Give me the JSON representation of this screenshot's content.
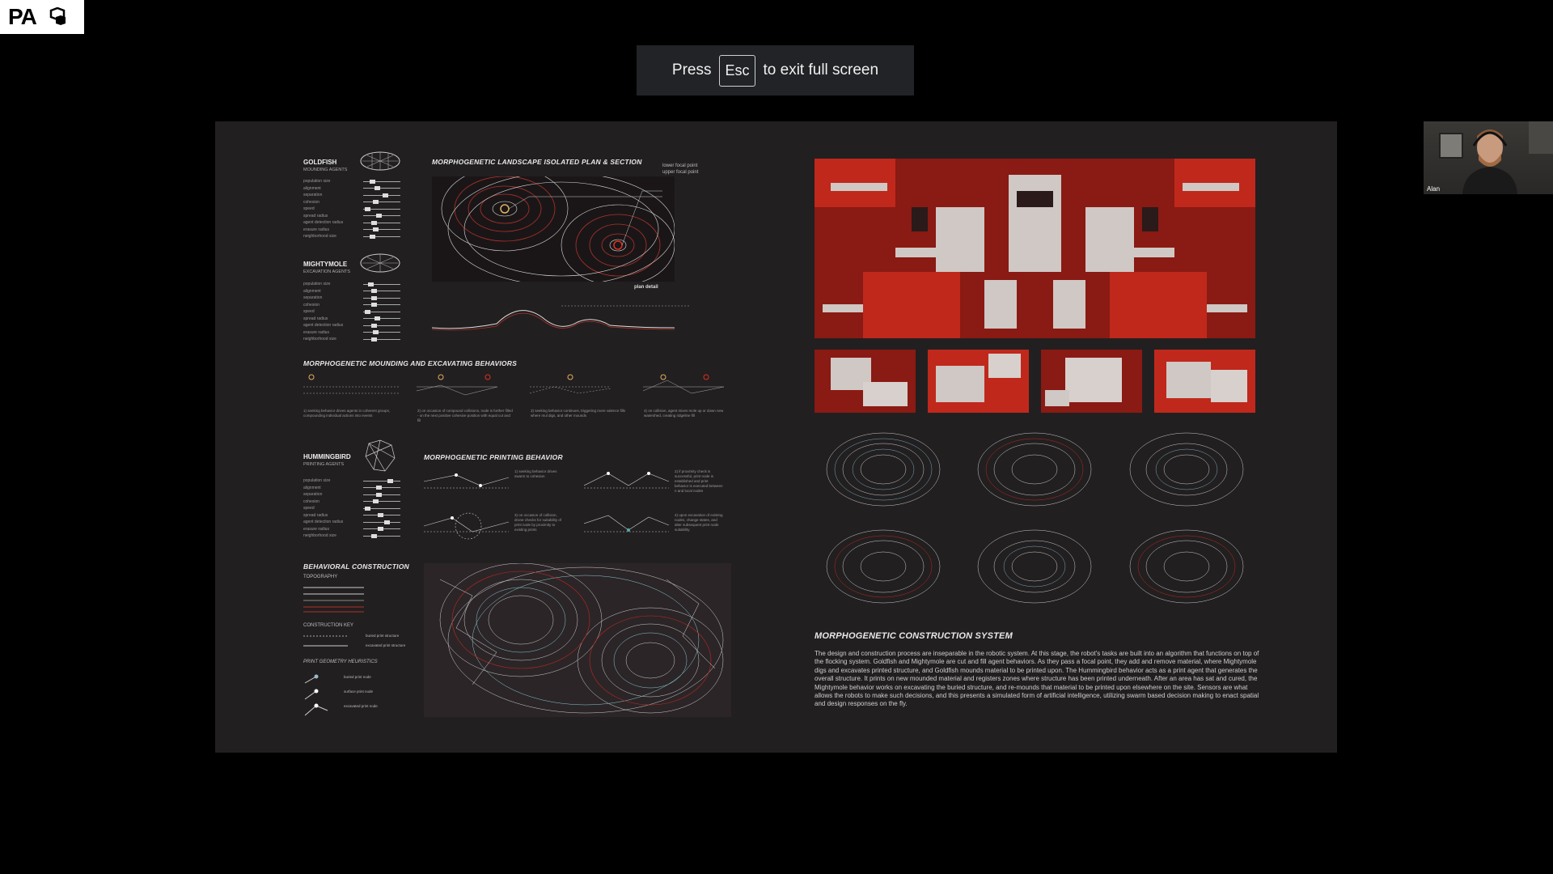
{
  "logo": {
    "text": "PA"
  },
  "fullscreen_toast": {
    "press": "Press",
    "key": "Esc",
    "rest": "to exit full screen"
  },
  "participant": {
    "name": "Alan"
  },
  "slide": {
    "goldfish": {
      "name": "GOLDFISH",
      "sub": "MOUNDING AGENTS",
      "params": [
        "population size",
        "alignment",
        "separation",
        "cohesion",
        "speed",
        "spread radius",
        "agent detection radius",
        "erasure radius",
        "neighborhood size"
      ]
    },
    "mightymole": {
      "name": "MIGHTYMOLE",
      "sub": "EXCAVATION AGENTS",
      "params": [
        "population size",
        "alignment",
        "separation",
        "cohesion",
        "speed",
        "spread radius",
        "agent detection radius",
        "erasure radius",
        "neighborhood size"
      ]
    },
    "hummingbird": {
      "name": "HUMMINGBIRD",
      "sub": "PRINTING AGENTS",
      "params": [
        "population size",
        "alignment",
        "separation",
        "cohesion",
        "speed",
        "spread radius",
        "agent detection radius",
        "erasure radius",
        "neighborhood size"
      ]
    },
    "landscape_title": "MORPHOGENETIC LANDSCAPE ISOLATED PLAN & SECTION",
    "landscape_legend": [
      "lower focal point",
      "upper focal point"
    ],
    "plan_detail": "plan detail",
    "mounding_title": "MORPHOGENETIC MOUNDING AND EXCAVATING BEHAVIORS",
    "mounding_captions": [
      "1) seeking behavior drives agents in coherent groups, compounding individual actions into events",
      "2) on occasion of compound collisions, node is further filled - on the next positive cohesive position with equal cut and fill",
      "3) seeking behavior continues, triggering more valence fills where mul digs, and other mounds",
      "4) on collision, agent mixes mole up or down new watershed, creating ridgeline fill"
    ],
    "printing_title": "MORPHOGENETIC PRINTING BEHAVIOR",
    "printing_captions": [
      "1) seeking behavior drives swarm to cohesion",
      "2) if proximity check is successful, print node is established and print behavior is executed between n and local nodes",
      "3) on occasion of collision, drone checks for suitability of print node by proximity to existing prints",
      "4) upon excavation of existing nodes, change states, and alter subsequent print node suitability"
    ],
    "construction_title": "BEHAVIORAL CONSTRUCTION",
    "topography": "TOPOGRAPHY",
    "construction_key": "CONSTRUCTION KEY",
    "key_items": [
      "buried print structure",
      "excavated print structure"
    ],
    "heuristics": "PRINT GEOMETRY HEURISTICS",
    "heuristic_items": [
      "buried print node",
      "surface print node",
      "excavated print node"
    ],
    "system_title": "MORPHOGENETIC CONSTRUCTION SYSTEM",
    "system_text": "The design and construction process are inseparable in the robotic system. At this stage, the robot's tasks are built into an algorithm that functions on top of the flocking system. Goldfish and Mightymole are cut and fill agent behaviors. As they pass a focal point, they add and remove material, where Mightymole digs and excavates printed structure, and Goldfish mounds material to be printed upon. The Hummingbird behavior acts as a print agent that generates the overall structure. It prints on new mounded material and registers zones where structure has been printed underneath. After an area has sat and cured, the Mightymole behavior works on excavating the buried structure, and re-mounds that material to be printed upon elsewhere on the site. Sensors are what allows the robots to make such decisions, and this presents a simulated form of artificial intelligence, utilizing swarm based decision making to enact spatial and design responses on the fly."
  },
  "colors": {
    "accent_red": "#c0281c",
    "slide_bg": "#221f20",
    "toast_bg": "#212326"
  }
}
